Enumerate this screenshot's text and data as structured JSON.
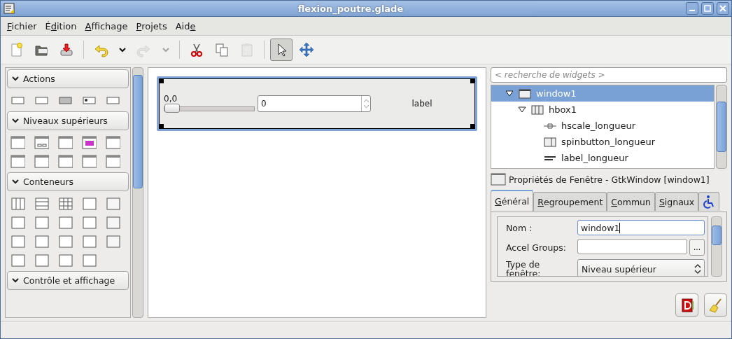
{
  "window": {
    "title": "flexion_poutre.glade"
  },
  "menu": [
    {
      "key": "F",
      "post": "ichier"
    },
    {
      "pre": "É",
      "key": "d",
      "post": "ition"
    },
    {
      "key": "A",
      "post": "ffichage"
    },
    {
      "key": "P",
      "post": "rojets"
    },
    {
      "pre": "Aid",
      "key": "e"
    }
  ],
  "toolbar": [
    {
      "kind": "new",
      "disabled": false,
      "on": false
    },
    {
      "kind": "open",
      "disabled": false,
      "on": false
    },
    {
      "kind": "save",
      "disabled": false,
      "on": false
    },
    {
      "kind": "sep"
    },
    {
      "kind": "undo",
      "disabled": false,
      "on": false
    },
    {
      "kind": "caret",
      "disabled": false,
      "on": false
    },
    {
      "kind": "redo",
      "disabled": true,
      "on": false
    },
    {
      "kind": "caret",
      "disabled": true,
      "on": false
    },
    {
      "kind": "sep"
    },
    {
      "kind": "cut",
      "disabled": false,
      "on": false
    },
    {
      "kind": "copy",
      "disabled": false,
      "on": false
    },
    {
      "kind": "paste",
      "disabled": true,
      "on": false
    },
    {
      "kind": "sep"
    },
    {
      "kind": "pointer",
      "disabled": false,
      "on": true
    },
    {
      "kind": "move",
      "disabled": false,
      "on": false
    }
  ],
  "palette": [
    {
      "title": "Actions"
    },
    {
      "title": "Niveaux supérieurs"
    },
    {
      "title": "Conteneurs"
    },
    {
      "title": "Contrôle et affichage"
    }
  ],
  "canvas": {
    "scale_value": "0,0",
    "scale": {
      "level": 0
    },
    "spin_value": "0",
    "label": "label"
  },
  "search": {
    "placeholder": "< recherche de widgets >"
  },
  "tree": [
    {
      "name": "window1",
      "kind": "window",
      "selected": true,
      "expanded": true,
      "children": [
        {
          "name": "hbox1",
          "kind": "hbox",
          "selected": false,
          "expanded": true,
          "children": [
            {
              "name": "hscale_longueur",
              "kind": "hscale",
              "selected": false
            },
            {
              "name": "spinbutton_longueur",
              "kind": "spin",
              "selected": false
            },
            {
              "name": "label_longueur",
              "kind": "label",
              "selected": false
            }
          ]
        }
      ]
    }
  ],
  "properties": {
    "title": "Propriétés de Fenêtre - GtkWindow [window1]",
    "tabs": [
      {
        "key": "G",
        "post": "énéral",
        "selected": true
      },
      {
        "key": "R",
        "post": "egroupement",
        "selected": false
      },
      {
        "key": "C",
        "post": "ommun",
        "selected": false
      },
      {
        "key": "S",
        "post": "ignaux",
        "selected": false
      },
      {
        "kind": "accessibility",
        "selected": false
      }
    ],
    "rows": [
      {
        "label": "Nom :",
        "kind": "entry",
        "value": "window1",
        "focused": true
      },
      {
        "label": "Accel Groups:",
        "kind": "entry-button",
        "button": "..."
      },
      {
        "label": "Type de fenêtre:",
        "kind": "combo",
        "value": "Niveau supérieur"
      }
    ]
  }
}
